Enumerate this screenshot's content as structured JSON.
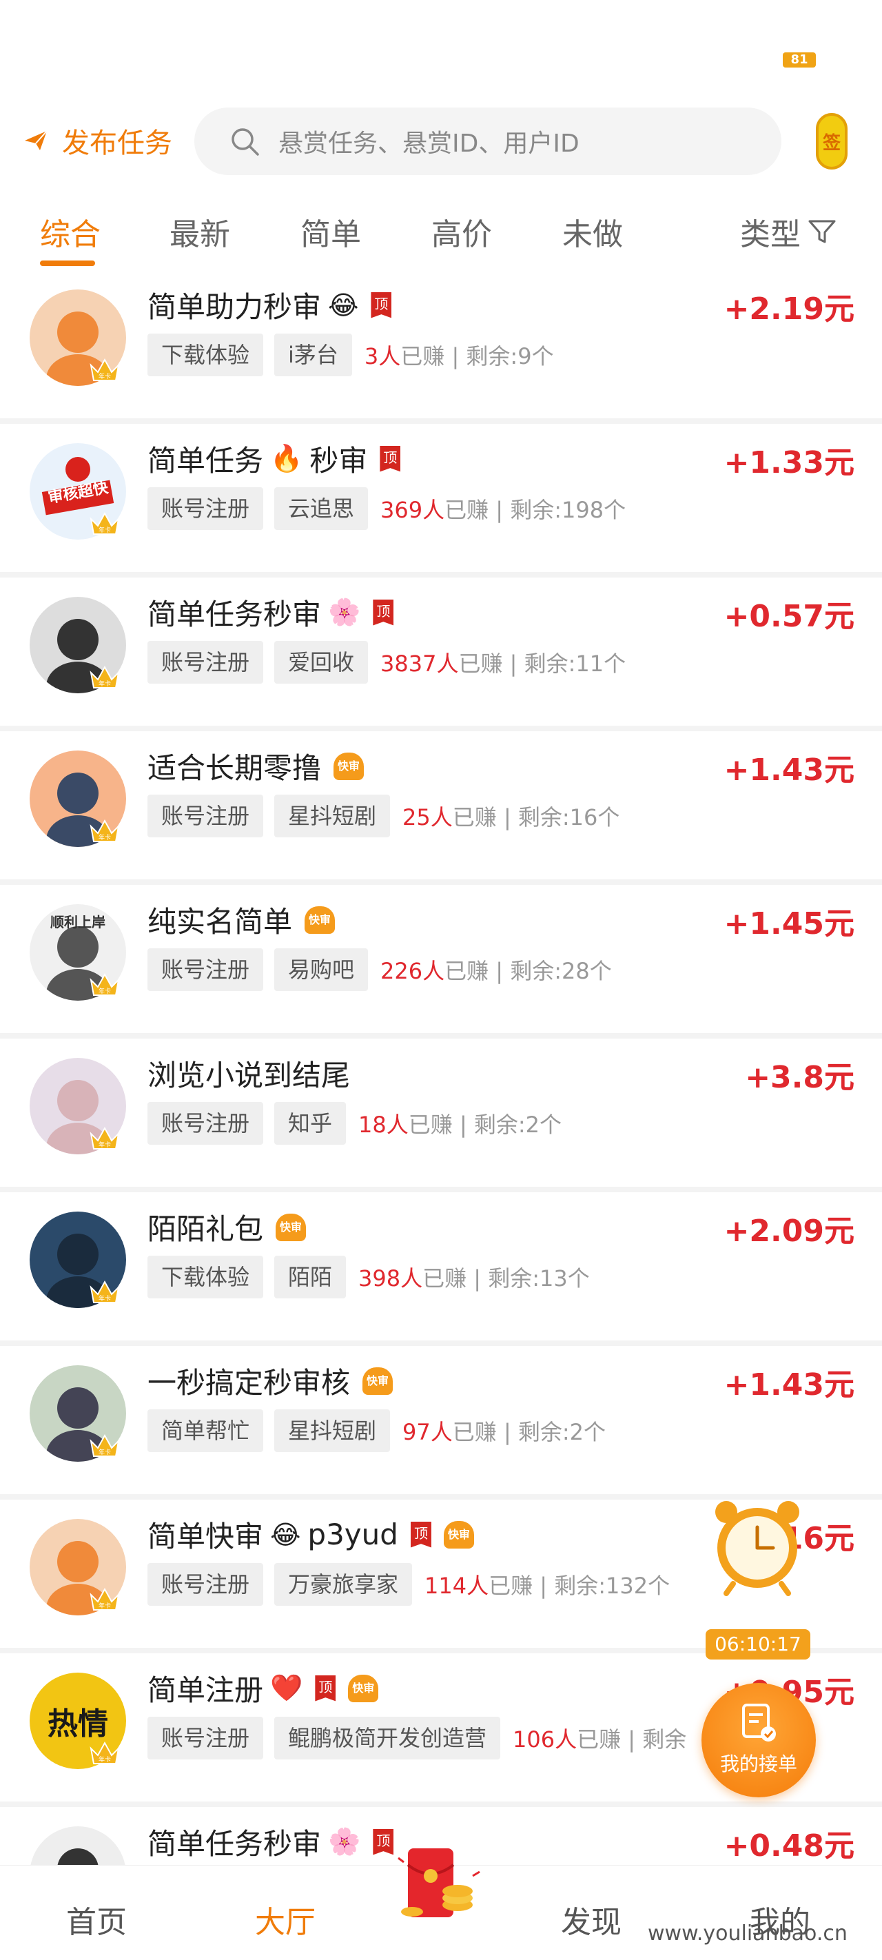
{
  "status_bar": {
    "battery": "81"
  },
  "header": {
    "publish_label": "发布任务",
    "search_placeholder": "悬赏任务、悬赏ID、用户ID",
    "sign_label": "签"
  },
  "tabs": [
    {
      "label": "综合",
      "active": true
    },
    {
      "label": "最新"
    },
    {
      "label": "简单"
    },
    {
      "label": "高价"
    },
    {
      "label": "未做"
    }
  ],
  "filter_label": "类型",
  "tasks": [
    {
      "title": "简单助力秒审",
      "emoji": "😂",
      "badges": [
        "顶"
      ],
      "price": "+2.19元",
      "tag1": "下载体验",
      "tag2": "i茅台",
      "count": "3人",
      "earned": "已赚",
      "remaining": "剩余:9个"
    },
    {
      "title": "简单任务",
      "emoji": "🔥",
      "title_suffix": "秒审",
      "badges": [
        "顶"
      ],
      "price": "+1.33元",
      "tag1": "账号注册",
      "tag2": "云追思",
      "count": "369人",
      "earned": "已赚",
      "remaining": "剩余:198个"
    },
    {
      "title": "简单任务秒审",
      "emoji": "🌸",
      "badges": [
        "顶"
      ],
      "price": "+0.57元",
      "tag1": "账号注册",
      "tag2": "爱回收",
      "count": "3837人",
      "earned": "已赚",
      "remaining": "剩余:11个"
    },
    {
      "title": "适合长期零撸",
      "emoji": "",
      "badges": [
        "快审"
      ],
      "price": "+1.43元",
      "tag1": "账号注册",
      "tag2": "星抖短剧",
      "count": "25人",
      "earned": "已赚",
      "remaining": "剩余:16个"
    },
    {
      "title": "纯实名简单",
      "emoji": "",
      "badges": [
        "快审"
      ],
      "price": "+1.45元",
      "tag1": "账号注册",
      "tag2": "易购吧",
      "count": "226人",
      "earned": "已赚",
      "remaining": "剩余:28个"
    },
    {
      "title": "浏览小说到结尾",
      "emoji": "",
      "badges": [],
      "price": "+3.8元",
      "tag1": "账号注册",
      "tag2": "知乎",
      "count": "18人",
      "earned": "已赚",
      "remaining": "剩余:2个"
    },
    {
      "title": "陌陌礼包",
      "emoji": "",
      "badges": [
        "快审"
      ],
      "price": "+2.09元",
      "tag1": "下载体验",
      "tag2": "陌陌",
      "count": "398人",
      "earned": "已赚",
      "remaining": "剩余:13个"
    },
    {
      "title": "一秒搞定秒审核",
      "emoji": "",
      "badges": [
        "快审"
      ],
      "price": "+1.43元",
      "tag1": "简单帮忙",
      "tag2": "星抖短剧",
      "count": "97人",
      "earned": "已赚",
      "remaining": "剩余:2个"
    },
    {
      "title": "简单快审",
      "emoji": "😂",
      "title_suffix": "p3yud",
      "badges": [
        "顶",
        "快审"
      ],
      "price": "+1.16元",
      "tag1": "账号注册",
      "tag2": "万豪旅享家",
      "count": "114人",
      "earned": "已赚",
      "remaining": "剩余:132个"
    },
    {
      "title": "简单注册",
      "emoji": "❤️",
      "badges": [
        "顶",
        "快审"
      ],
      "price": "+0.95元",
      "tag1": "账号注册",
      "tag2": "鲲鹏极简开发创造营",
      "count": "106人",
      "earned": "已赚",
      "remaining": "剩余"
    },
    {
      "title": "简单任务秒审",
      "emoji": "🌸",
      "badges": [
        "顶"
      ],
      "price": "+0.48元",
      "tag1": "",
      "tag2": "",
      "count": "",
      "earned": "",
      "remaining": ""
    }
  ],
  "avatar_texts": {
    "a2": "审核超快",
    "a5": "顺利上岸",
    "a10": "热情"
  },
  "crown_label": "年卡",
  "floating": {
    "timer": "06:10:17",
    "my_orders": "我的接单"
  },
  "bottom_nav": [
    {
      "label": "首页"
    },
    {
      "label": "大厅",
      "active": true
    },
    {
      "label": "发现"
    },
    {
      "label": "我的"
    }
  ],
  "watermark": "www.youlianbao.cn",
  "colors": {
    "accent": "#f07c0a",
    "price": "#e0282e",
    "badge_top": "#d3261f",
    "badge_fast": "#f59b1b"
  }
}
